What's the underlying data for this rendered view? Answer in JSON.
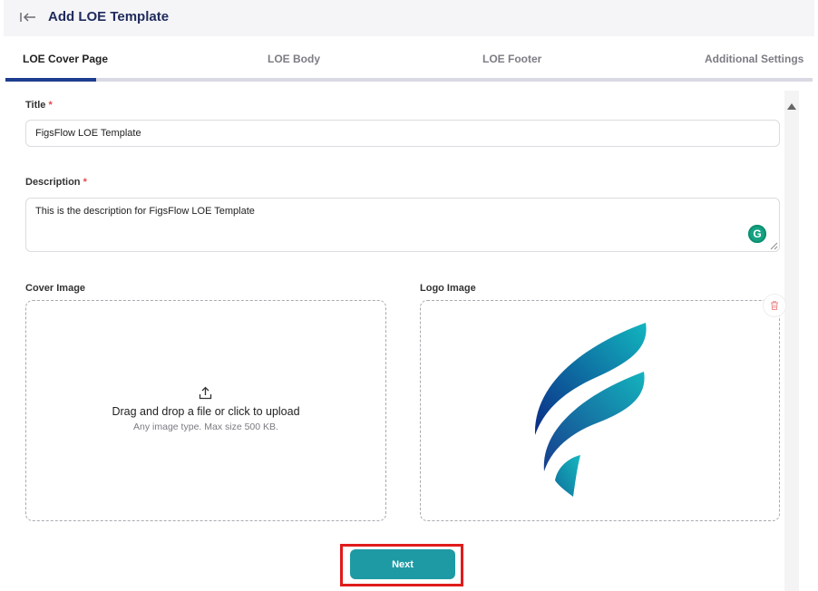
{
  "header": {
    "title": "Add LOE Template",
    "back_icon": "collapse-left-arrow-icon"
  },
  "tabs": [
    {
      "label": "LOE Cover Page",
      "active": true
    },
    {
      "label": "LOE Body",
      "active": false
    },
    {
      "label": "LOE Footer",
      "active": false
    },
    {
      "label": "Additional Settings",
      "active": false
    }
  ],
  "form": {
    "title_label": "Title",
    "title_value": "FigsFlow LOE Template",
    "description_label": "Description",
    "description_value": "This is the description for FigsFlow LOE Template",
    "required_mark": "*",
    "cover_image_label": "Cover Image",
    "logo_image_label": "Logo Image",
    "upload_title": "Drag and drop a file or click to upload",
    "upload_hint": "Any image type. Max size 500 KB.",
    "grammarly_letter": "G"
  },
  "actions": {
    "next_label": "Next"
  },
  "colors": {
    "header_title": "#1f2a5c",
    "tab_indicator": "#1d3d8f",
    "next_button": "#1e9aa4",
    "highlight": "#e01b1b",
    "required": "#e5484d",
    "logo_gradient_start": "#0b2b86",
    "logo_gradient_end": "#12b5bf"
  }
}
